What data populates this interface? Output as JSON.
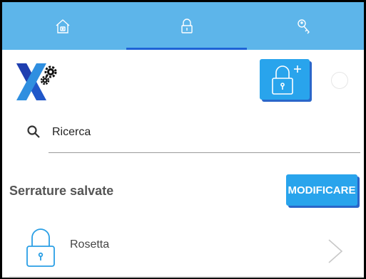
{
  "tabs": [
    {
      "icon": "home-icon",
      "active": false
    },
    {
      "icon": "lock-icon",
      "active": true
    },
    {
      "icon": "key-icon",
      "active": false
    }
  ],
  "header": {
    "logo": "x-gears-logo",
    "add_lock_icon": "lock-plus-icon"
  },
  "search": {
    "placeholder": "Ricerca",
    "value": ""
  },
  "section": {
    "title": "Serrature salvate",
    "edit_label": "MODIFICARE"
  },
  "locks": [
    {
      "name": "Rosetta",
      "icon": "lock-icon"
    }
  ],
  "colors": {
    "tabbar": "#5db5ea",
    "accent": "#29a4ec",
    "accent_shadow": "#2a66c9",
    "tab_indicator": "#1e63d6"
  }
}
